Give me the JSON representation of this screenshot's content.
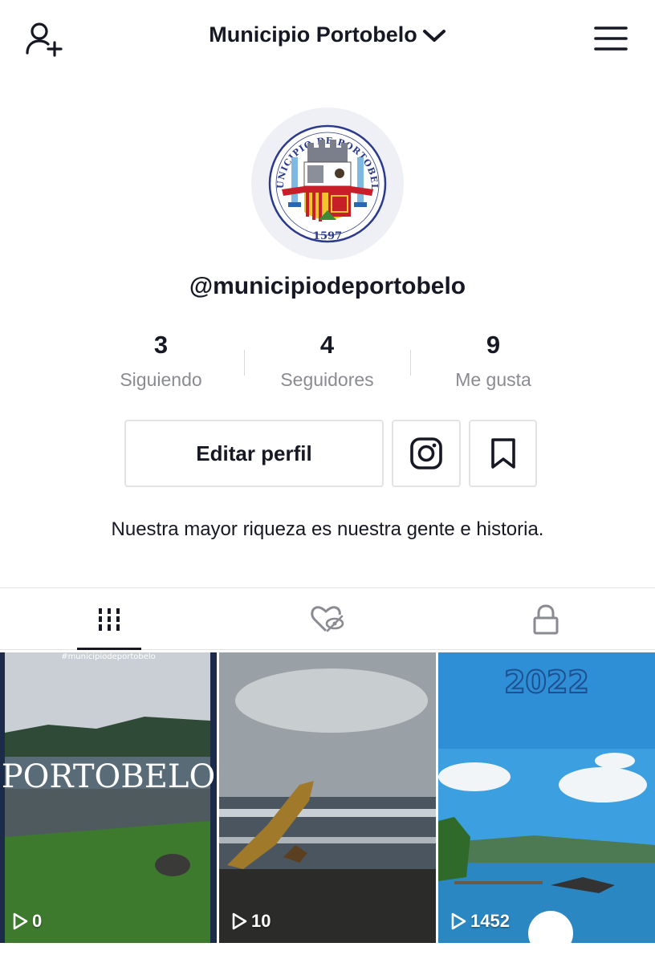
{
  "header": {
    "title": "Municipio Portobelo",
    "icons": {
      "left": "add-user-icon",
      "title_caret": "chevron-down-icon",
      "right": "menu-icon"
    }
  },
  "profile": {
    "avatar_logo": {
      "arc_text": "MUNICIPIO DE PORTOBELO",
      "year": "1597"
    },
    "handle": "@municipiodeportobelo",
    "bio": "Nuestra mayor riqueza es nuestra gente e historia."
  },
  "stats": [
    {
      "value": "3",
      "label": "Siguiendo"
    },
    {
      "value": "4",
      "label": "Seguidores"
    },
    {
      "value": "9",
      "label": "Me gusta"
    }
  ],
  "actions": {
    "edit_label": "Editar perfil",
    "instagram_icon": "instagram-icon",
    "bookmark_icon": "bookmark-icon"
  },
  "tabs": [
    {
      "icon": "videos-grid-icon",
      "active": true
    },
    {
      "icon": "liked-hidden-icon",
      "active": false
    },
    {
      "icon": "lock-icon",
      "active": false
    }
  ],
  "videos": [
    {
      "plays": "0",
      "overlay_top": "#municipiodeportobelo",
      "overlay_title": "PORTOBELO"
    },
    {
      "plays": "10",
      "overlay_top": "",
      "overlay_title": ""
    },
    {
      "plays": "1452",
      "overlay_top": "",
      "overlay_title": "2022"
    }
  ],
  "colors": {
    "text": "#161823",
    "muted": "#8a8b91",
    "border": "#e3e3e4",
    "tab_indicator": "#161823"
  }
}
